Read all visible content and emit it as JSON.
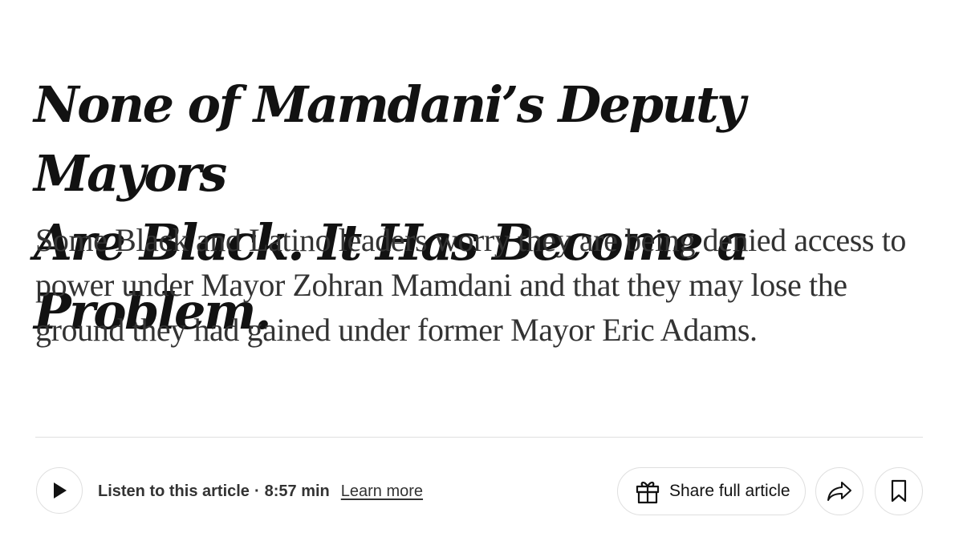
{
  "article": {
    "headline_line1": "None of Mamdani’s Deputy Mayors",
    "headline_line2": "Are Black. It Has Become a Problem.",
    "summary": "Some Black and Latino leaders worry they are being denied access to power under Mayor Zohran Mamdani and that they may lose the ground they had gained under former Mayor Eric Adams."
  },
  "audio": {
    "play_icon": "play-icon",
    "listen_label": "Listen to this article",
    "separator": "·",
    "duration": "8:57 min",
    "learn_more": "Learn more"
  },
  "actions": {
    "share_full_label": "Share full article",
    "gift_icon": "gift-icon",
    "share_icon": "share-arrow-icon",
    "save_icon": "bookmark-icon"
  }
}
